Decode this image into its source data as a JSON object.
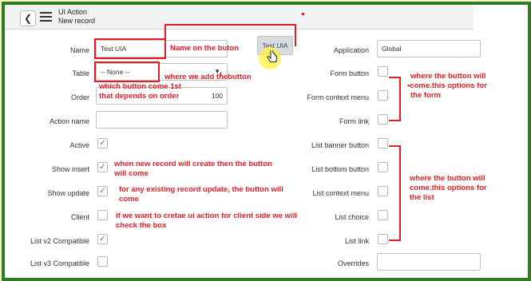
{
  "header": {
    "title": "UI Action",
    "subtitle": "New record"
  },
  "form": {
    "name_label": "Name",
    "name_value": "Test UIA",
    "table_label": "Table",
    "table_value": "-- None --",
    "order_label": "Order",
    "order_value": "100",
    "action_name_label": "Action name",
    "active_label": "Active",
    "show_insert_label": "Show insert",
    "show_update_label": "Show update",
    "client_label": "Client",
    "list_v2_label": "List v2 Compatible",
    "list_v3_label": "List v3 Compatible",
    "application_label": "Application",
    "application_value": "Global",
    "form_button_label": "Form button",
    "form_context_menu_label": "Form context menu",
    "form_link_label": "Form link",
    "list_banner_button_label": "List banner button",
    "list_bottom_button_label": "List bottom button",
    "list_context_menu_label": "List context menu",
    "list_choice_label": "List choice",
    "list_link_label": "List link",
    "overrides_label": "Overrides"
  },
  "preview_button": "Test UIA",
  "annotations": {
    "name_note": "Name on the buton",
    "table_note": "where we add thebutton",
    "order_note_1": "which button  come 1st",
    "order_note_2": "that depends on order",
    "insert_note_1": "when new record will create then the button",
    "insert_note_2": "will come",
    "update_note_1": "for any existing record update, the button will",
    "update_note_2": "come",
    "client_note_1": "if we want to cretae ui action for client side we will",
    "client_note_2": "check the box",
    "form_note_1": "where the button will",
    "form_note_2": "come.this options for",
    "form_note_3": "the form",
    "list_note_1": "where the button will",
    "list_note_2": "come.this options for",
    "list_note_3": "the list"
  },
  "colors": {
    "frame": "#2e7d1f",
    "annotation": "#e41e26",
    "check": "#2b7fd0",
    "background": "#f7f5c6"
  }
}
